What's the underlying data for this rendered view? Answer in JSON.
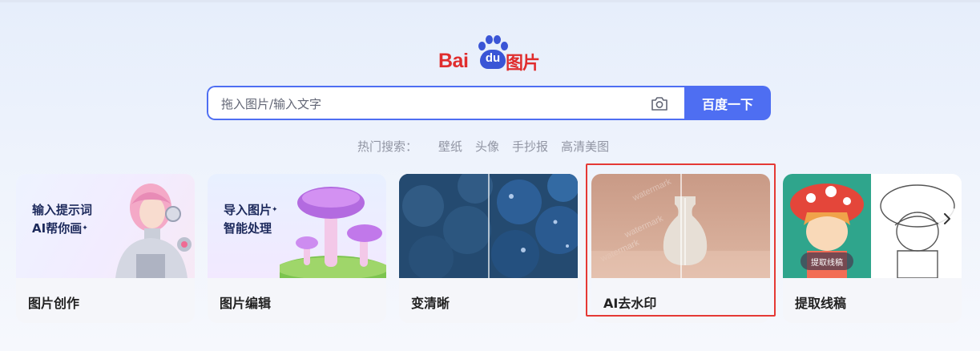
{
  "logo": {
    "brand": "Bai",
    "paw_text": "du",
    "product": "图片"
  },
  "search": {
    "placeholder": "拖入图片/输入文字",
    "value": "",
    "button_label": "百度一下"
  },
  "hot_search": {
    "label": "热门搜索：",
    "keywords": [
      "壁纸",
      "头像",
      "手抄报",
      "高清美图"
    ]
  },
  "cards": [
    {
      "caption": "图片创作",
      "banner_line1": "输入提示词",
      "banner_line2": "AI帮你画"
    },
    {
      "caption": "图片编辑",
      "banner_line1": "导入图片",
      "banner_line2": "智能处理"
    },
    {
      "caption": "变清晰"
    },
    {
      "caption": "AI去水印",
      "watermark_text": "watermark"
    },
    {
      "caption": "提取线稿",
      "pill": "提取线稿"
    }
  ],
  "colors": {
    "accent": "#4e6ef2",
    "brand_red": "#e02d2d",
    "highlight": "#e53935"
  },
  "icons": {
    "camera": "camera-icon",
    "next": "chevron-right-icon"
  }
}
